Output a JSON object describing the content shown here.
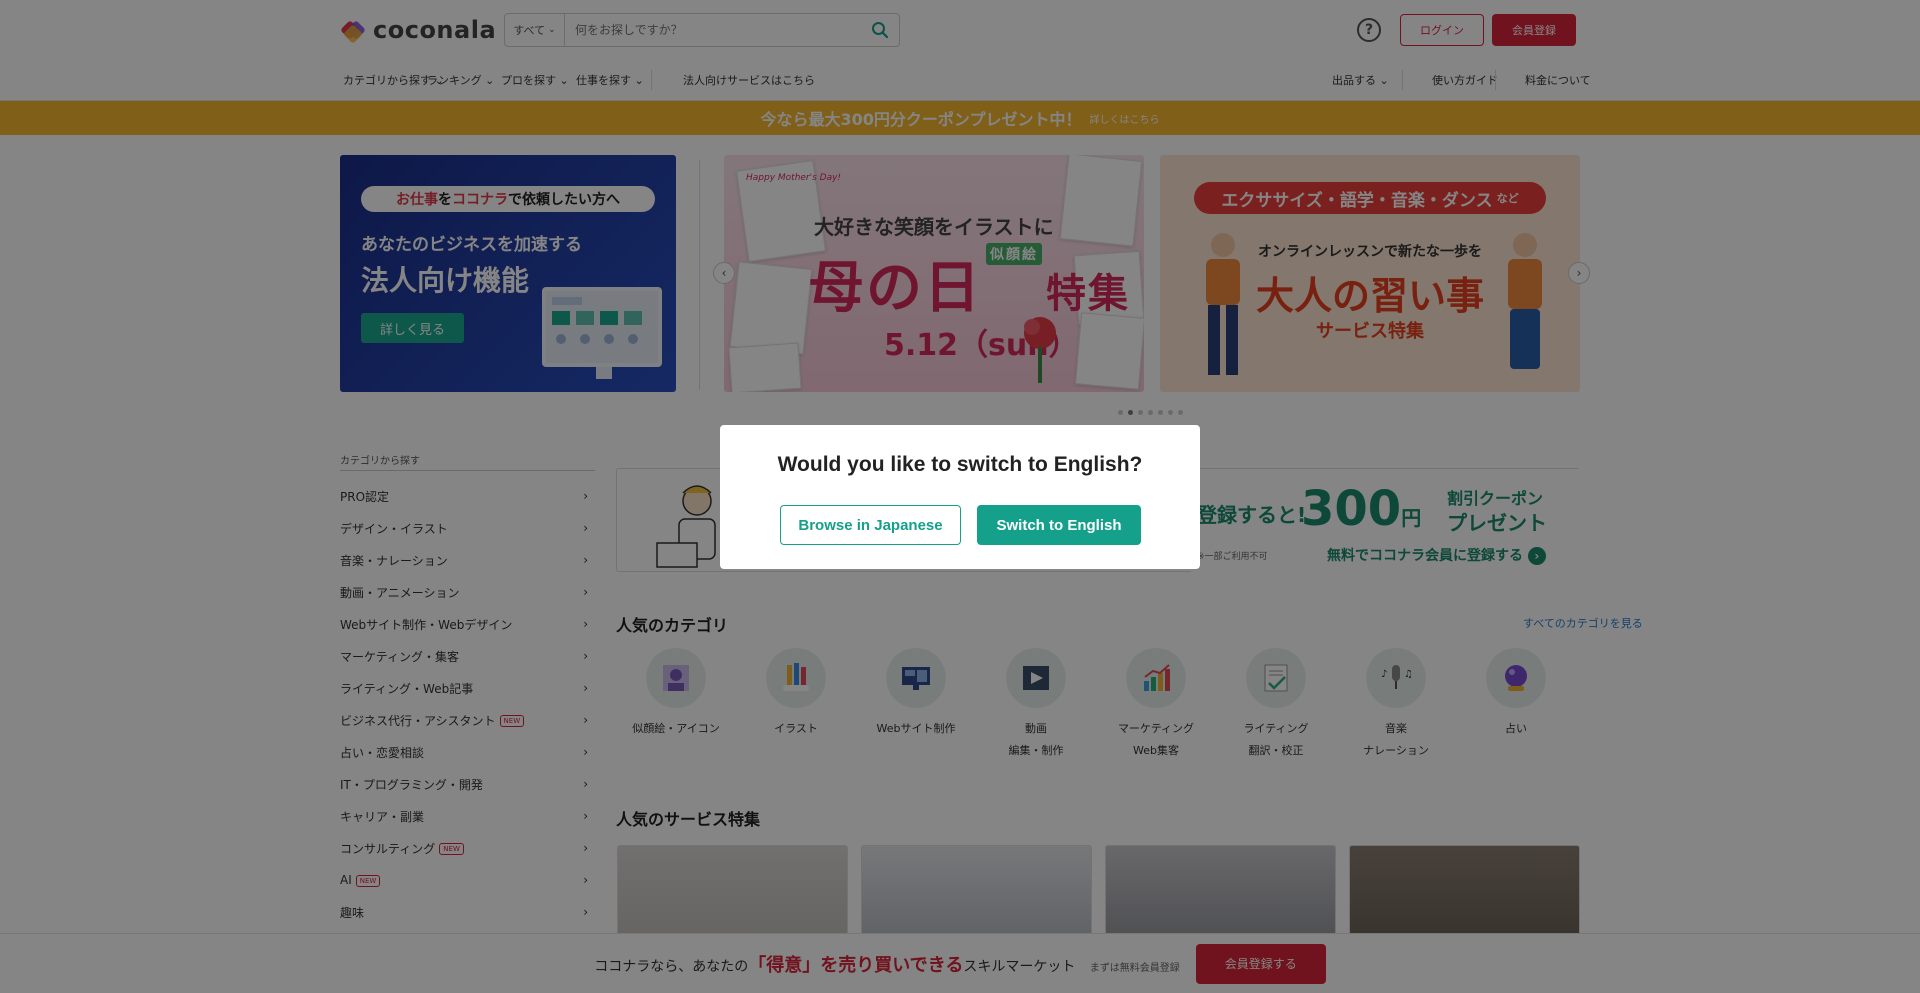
{
  "header": {
    "logo_text": "coconala",
    "search_category": "すべて",
    "search_placeholder": "何をお探しですか？",
    "help_icon": "?",
    "login_label": "ログイン",
    "register_label": "会員登録"
  },
  "nav": {
    "items": [
      "カテゴリから探す",
      "ランキング",
      "プロを探す",
      "仕事を探す",
      "法人向けサービスはこちら",
      "出品する",
      "使い方ガイド",
      "料金について"
    ]
  },
  "promo": {
    "text": "今なら最大300円分クーポンプレゼント中！",
    "note": "詳しくはこちら"
  },
  "hero_biz": {
    "tag_parts": [
      "お仕事",
      "を",
      "ココナラ",
      "で依頼したい方へ"
    ],
    "sub": "あなたのビジネスを加速する",
    "main": "法人向け機能",
    "cta": "詳しく見る"
  },
  "hero_mother": {
    "script": "Happy Mother's Day!",
    "t1": "大好きな笑顔をイラストに",
    "t2": "母の日",
    "t2b": "特集",
    "tag": "似顔絵",
    "t3": "5.12（sun）"
  },
  "hero_lesson": {
    "tag": "エクササイズ・語学・音楽・ダンス",
    "tag_suffix": "など",
    "s1": "オンラインレッスンで新たな一歩を",
    "s2": "大人の習い事",
    "s3": "サービス特集"
  },
  "sidebar": {
    "title": "カテゴリから探す",
    "items": [
      {
        "label": "PRO認定",
        "new": false
      },
      {
        "label": "デザイン・イラスト",
        "new": false
      },
      {
        "label": "音楽・ナレーション",
        "new": false
      },
      {
        "label": "動画・アニメーション",
        "new": false
      },
      {
        "label": "Webサイト制作・Webデザイン",
        "new": false
      },
      {
        "label": "マーケティング・集客",
        "new": false
      },
      {
        "label": "ライティング・Web記事",
        "new": false
      },
      {
        "label": "ビジネス代行・アシスタント",
        "new": true
      },
      {
        "label": "占い・恋愛相談",
        "new": false
      },
      {
        "label": "IT・プログラミング・開発",
        "new": false
      },
      {
        "label": "キャリア・副業",
        "new": false
      },
      {
        "label": "コンサルティング",
        "new": true
      },
      {
        "label": "AI",
        "new": true
      },
      {
        "label": "趣味",
        "new": false
      }
    ],
    "new_badge": "NEW"
  },
  "coupon": {
    "c1": "登録すると!",
    "amount": "300",
    "yen": "円",
    "c2": "割引クーポン",
    "c3": "プレゼント",
    "c4": "※一部ご利用不可",
    "c5": "無料でココナラ会員に登録する"
  },
  "categories": {
    "title": "人気のカテゴリ",
    "see_all": "すべてのカテゴリを見る",
    "items": [
      {
        "label1": "似顔絵・アイコン",
        "label2": "",
        "icon": "portrait-icon"
      },
      {
        "label1": "イラスト",
        "label2": "",
        "icon": "pencils-icon"
      },
      {
        "label1": "Webサイト制作",
        "label2": "",
        "icon": "monitor-icon"
      },
      {
        "label1": "動画",
        "label2": "編集・制作",
        "icon": "video-icon"
      },
      {
        "label1": "マーケティング",
        "label2": "Web集客",
        "icon": "chart-icon"
      },
      {
        "label1": "ライティング",
        "label2": "翻訳・校正",
        "icon": "document-icon"
      },
      {
        "label1": "音楽",
        "label2": "ナレーション",
        "icon": "microphone-icon"
      },
      {
        "label1": "占い",
        "label2": "",
        "icon": "crystal-ball-icon"
      }
    ]
  },
  "popular": {
    "title": "人気のサービス特集"
  },
  "sticky": {
    "pre": "ココナラなら、あなたの",
    "highlight": "「得意」を売り買いできる",
    "post": "スキルマーケット",
    "note": "まずは無料会員登録",
    "button": "会員登録する"
  },
  "modal": {
    "title": "Would you like to switch to English?",
    "browse_japanese": "Browse in Japanese",
    "switch_english": "Switch to English"
  },
  "colors": {
    "brand_red": "#d8263a",
    "modal_teal": "#15a08c",
    "promo_orange": "#f5b62e"
  }
}
